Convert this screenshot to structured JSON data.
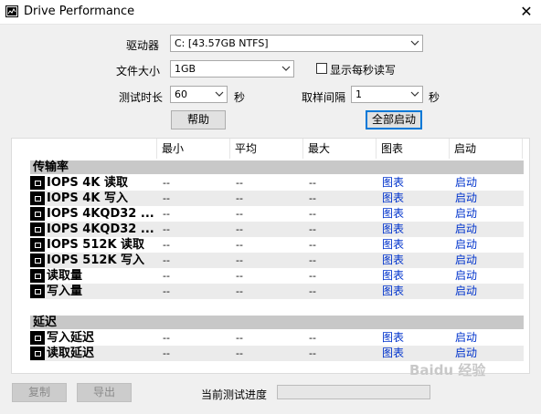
{
  "window": {
    "title": "Drive Performance"
  },
  "controls": {
    "drive": {
      "label": "驱动器",
      "value": "C: [43.57GB NTFS]"
    },
    "filesize": {
      "label": "文件大小",
      "value": "1GB"
    },
    "show_per_second": {
      "label": "显示每秒读写",
      "checked": false
    },
    "duration": {
      "label": "测试时长",
      "value": "60",
      "unit": "秒"
    },
    "interval": {
      "label": "取样间隔",
      "value": "1",
      "unit": "秒"
    },
    "help_button": "帮助",
    "start_all_button": "全部启动"
  },
  "table": {
    "columns": [
      "最小",
      "平均",
      "最大",
      "图表",
      "启动"
    ],
    "sections": [
      {
        "title": "传输率",
        "rows": [
          {
            "name": "IOPS 4K 读取",
            "min": "--",
            "avg": "--",
            "max": "--",
            "chart": "图表",
            "start": "启动"
          },
          {
            "name": "IOPS 4K 写入",
            "min": "--",
            "avg": "--",
            "max": "--",
            "chart": "图表",
            "start": "启动"
          },
          {
            "name": "IOPS 4KQD32 ...",
            "min": "--",
            "avg": "--",
            "max": "--",
            "chart": "图表",
            "start": "启动"
          },
          {
            "name": "IOPS 4KQD32 ...",
            "min": "--",
            "avg": "--",
            "max": "--",
            "chart": "图表",
            "start": "启动"
          },
          {
            "name": "IOPS 512K 读取",
            "min": "--",
            "avg": "--",
            "max": "--",
            "chart": "图表",
            "start": "启动"
          },
          {
            "name": "IOPS 512K 写入",
            "min": "--",
            "avg": "--",
            "max": "--",
            "chart": "图表",
            "start": "启动"
          },
          {
            "name": "读取量",
            "min": "--",
            "avg": "--",
            "max": "--",
            "chart": "图表",
            "start": "启动"
          },
          {
            "name": "写入量",
            "min": "--",
            "avg": "--",
            "max": "--",
            "chart": "图表",
            "start": "启动"
          }
        ]
      },
      {
        "title": "延迟",
        "rows": [
          {
            "name": "写入延迟",
            "min": "--",
            "avg": "--",
            "max": "--",
            "chart": "图表",
            "start": "启动"
          },
          {
            "name": "读取延迟",
            "min": "--",
            "avg": "--",
            "max": "--",
            "chart": "图表",
            "start": "启动"
          }
        ]
      }
    ]
  },
  "footer": {
    "copy_button": "复制",
    "export_button": "导出",
    "progress_label": "当前测试进度",
    "progress": 0
  },
  "watermark": "Baidu 经验"
}
